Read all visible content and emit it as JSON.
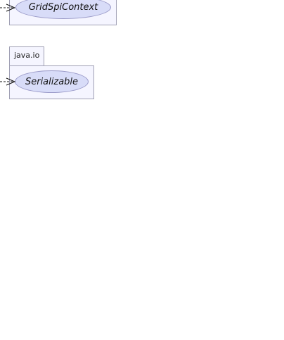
{
  "packages": [
    {
      "name": "",
      "node": {
        "label": "GridSpiContext",
        "kind": "interface"
      }
    },
    {
      "name": "java.io",
      "node": {
        "label": "Serializable",
        "kind": "interface"
      }
    }
  ],
  "colors": {
    "package_fill": "#f5f5ff",
    "package_border": "#a0a0b4",
    "node_fill": "#d8dcf8",
    "node_border": "#9a9ac8",
    "edge": "#111111"
  }
}
